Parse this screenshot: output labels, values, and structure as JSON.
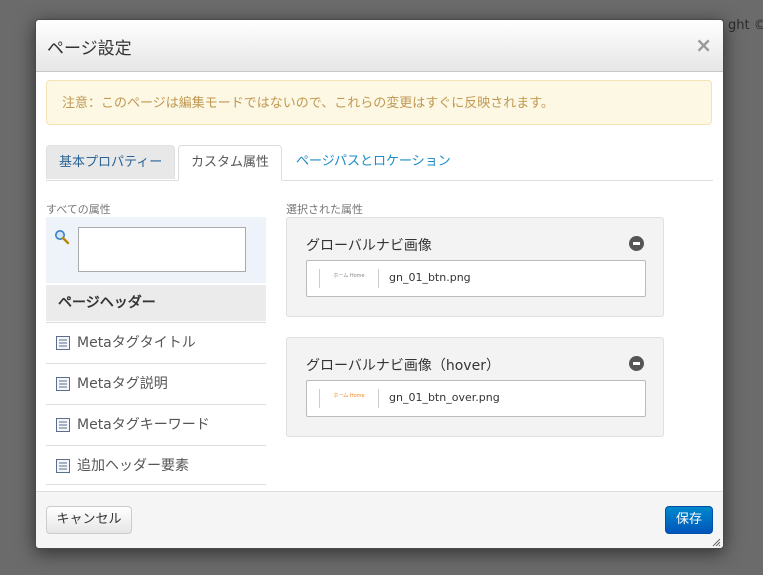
{
  "background": {
    "copyright_fragment": "ght © z"
  },
  "dialog": {
    "title": "ページ設定",
    "close_label": "×",
    "notice": "注意：このページは編集モードではないので、これらの変更はすぐに反映されます。",
    "tabs": [
      {
        "label": "基本プロパティー"
      },
      {
        "label": "カスタム属性"
      },
      {
        "label": "ページパスとロケーション"
      }
    ],
    "all_attributes": {
      "label": "すべての属性",
      "search_value": "",
      "group_header": "ページヘッダー",
      "items": [
        {
          "label": "Metaタグタイトル"
        },
        {
          "label": "Metaタグ説明"
        },
        {
          "label": "Metaタグキーワード"
        },
        {
          "label": "追加ヘッダー要素"
        }
      ]
    },
    "selected_attributes": {
      "label": "選択された属性",
      "panels": [
        {
          "title": "グローバルナビ画像",
          "file": "gn_01_btn.png",
          "thumb_text": "ホーム Home"
        },
        {
          "title": "グローバルナビ画像（hover）",
          "file": "gn_01_btn_over.png",
          "thumb_text": "ホーム Home"
        }
      ]
    },
    "footer": {
      "cancel_label": "キャンセル",
      "save_label": "保存"
    }
  },
  "colors": {
    "accent": "#0077cc",
    "notice_bg": "#fcf8e3",
    "notice_text": "#c09853",
    "thumb_hover": "#f08a24"
  }
}
